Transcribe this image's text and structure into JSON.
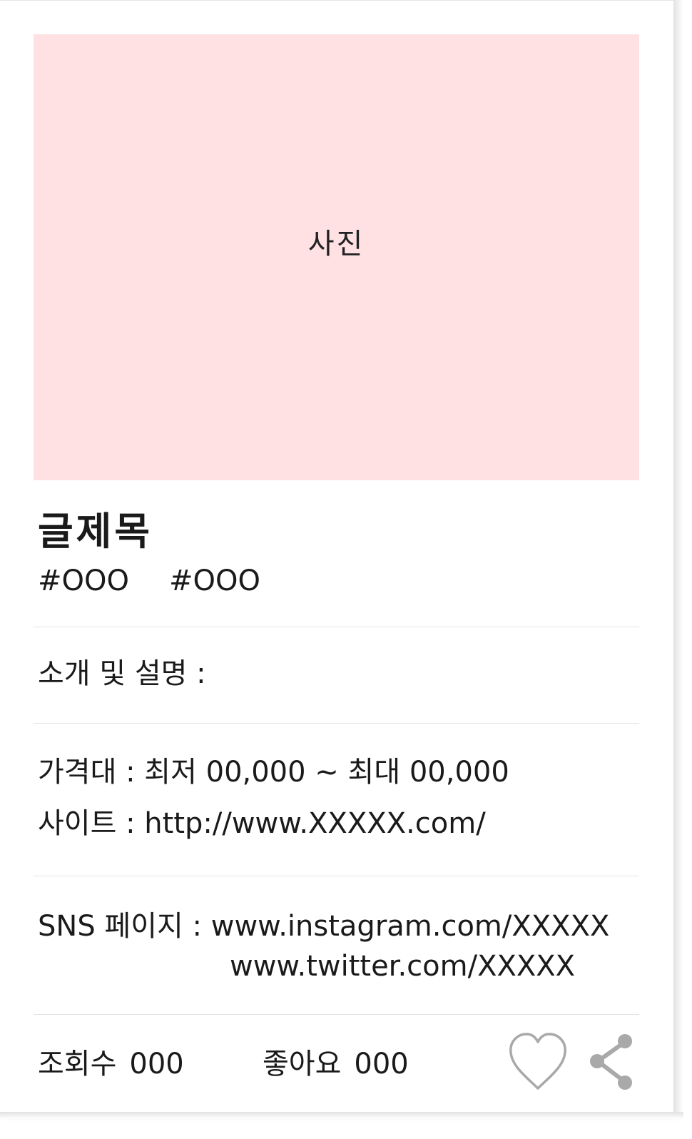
{
  "colors": {
    "photo_bg": "#ffe1e4",
    "icon_gray": "#a9a9a9"
  },
  "photo": {
    "label": "사진"
  },
  "post": {
    "title": "글제목",
    "tags": [
      "#OOO",
      "#OOO"
    ]
  },
  "description": {
    "label": "소개 및 설명 :"
  },
  "price": {
    "text": "가격대 : 최저 00,000 ~ 최대 00,000"
  },
  "site": {
    "text": "사이트 : http://www.XXXXX.com/"
  },
  "sns": {
    "label": "SNS 페이지 : ",
    "links": [
      "www.instagram.com/XXXXX",
      "www.twitter.com/XXXXX"
    ]
  },
  "stats": {
    "views_label": "조회수",
    "views_value": "000",
    "likes_label": "좋아요",
    "likes_value": "000"
  },
  "icons": {
    "like": "heart-outline-icon",
    "share": "share-icon"
  }
}
